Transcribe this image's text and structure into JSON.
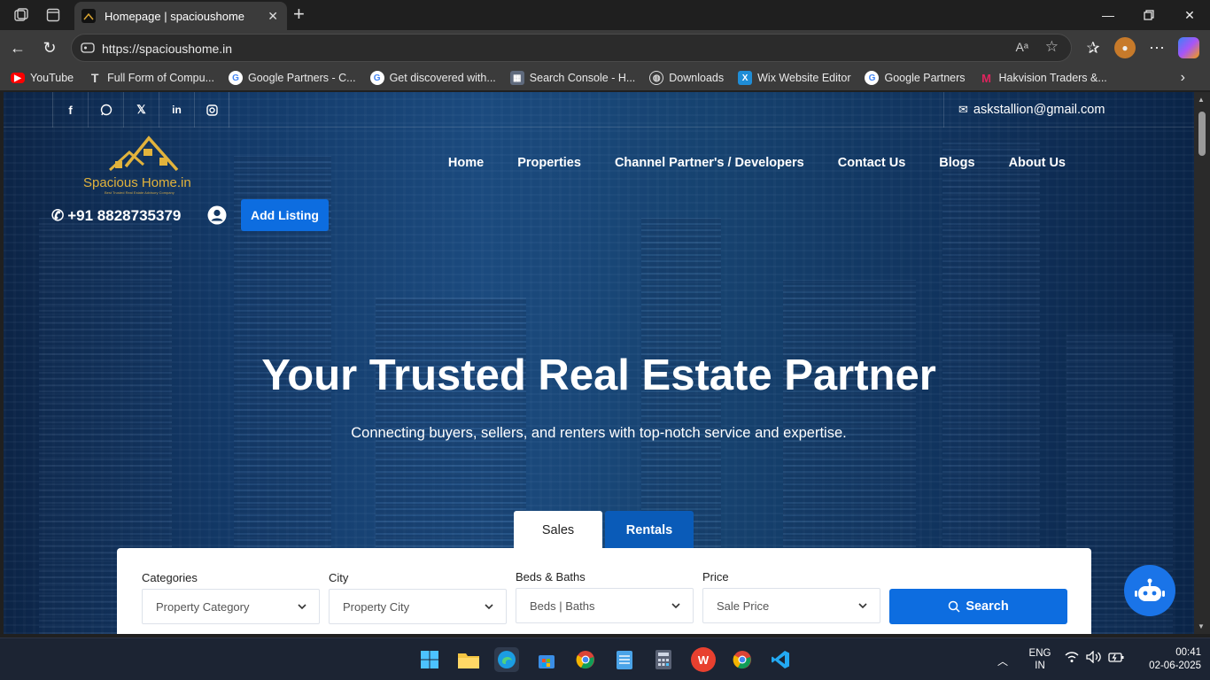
{
  "browser": {
    "tab_title": "Homepage | spacioushome",
    "address": "https://spacioushome.in",
    "bookmarks": [
      "YouTube",
      "Full Form of Compu...",
      "Google Partners - C...",
      "Get discovered with...",
      "Search Console - H...",
      "Downloads",
      "Wix Website Editor",
      "Google Partners",
      "Hakvision Traders &..."
    ]
  },
  "site": {
    "email": "askstallion@gmail.com",
    "logo_text": "Spacious Home.in",
    "logo_tagline": "Best Trusted Real Estate Advisory Company",
    "nav": [
      "Home",
      "Properties",
      "Channel Partner's / Developers",
      "Contact Us",
      "Blogs",
      "About Us"
    ],
    "phone": "+91 8828735379",
    "add_listing": "Add Listing"
  },
  "hero": {
    "title": "Your Trusted Real Estate Partner",
    "subtitle": "Connecting buyers, sellers, and renters with top-notch service and expertise."
  },
  "search": {
    "tabs": [
      "Sales",
      "Rentals"
    ],
    "categories_label": "Categories",
    "categories_value": "Property Category",
    "city_label": "City",
    "city_value": "Property City",
    "beds_label": "Beds & Baths",
    "beds_value": "Beds | Baths",
    "price_label": "Price",
    "price_value": "Sale Price",
    "button": "Search"
  },
  "taskbar": {
    "lang1": "ENG",
    "lang2": "IN",
    "time": "00:41",
    "date": "02-06-2025"
  },
  "colors": {
    "accent": "#0d6de0",
    "logo_gold": "#e2b33c"
  }
}
